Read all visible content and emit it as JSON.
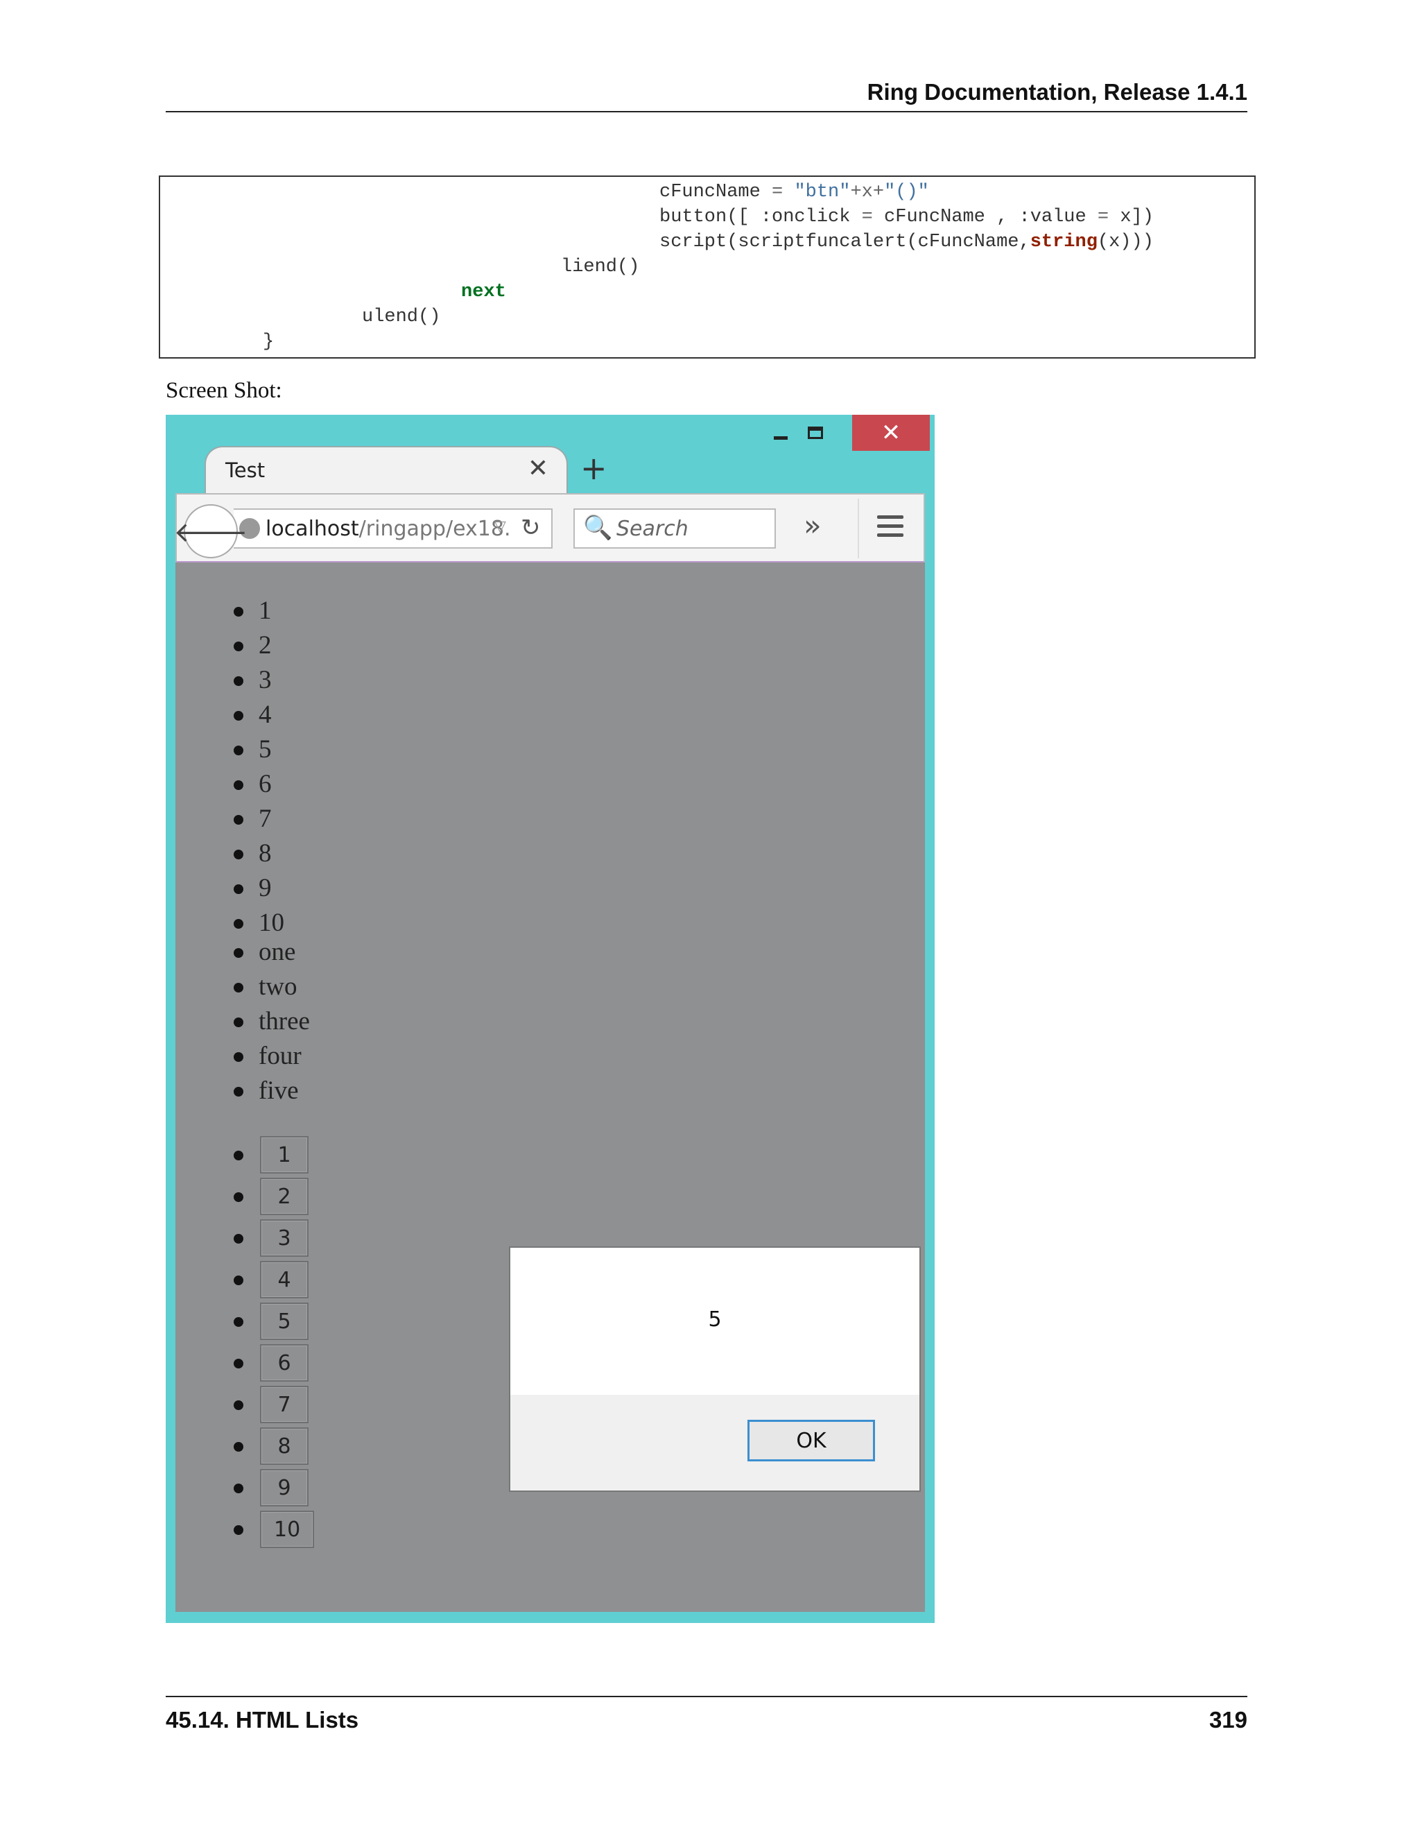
{
  "header": {
    "title": "Ring Documentation, Release 1.4.1"
  },
  "code": {
    "line1": {
      "a": "cFuncName ",
      "op": "= ",
      "str": "\"btn\"",
      "b": "+x+",
      "str2": "\"()\""
    },
    "line2": {
      "a": "button([ :onclick ",
      "op": "=",
      "b": " cFuncName , :value ",
      "op2": "=",
      "c": " x])"
    },
    "line3": {
      "a": "script(scriptfuncalert(cFuncName,",
      "fn": "string",
      "b": "(x)))"
    },
    "line4": "liend()",
    "line5": "next",
    "line6": "ulend()",
    "line7": "}"
  },
  "caption": "Screen Shot:",
  "browser": {
    "tab_title": "Test",
    "new_tab": "+",
    "url_host": "localhost",
    "url_path": "/ringapp/ex18.",
    "search_placeholder": "Search",
    "overflow": "»",
    "close": "✕",
    "tab_close": "✕",
    "back": "🡐",
    "reload": "↻",
    "dropdown": "▽",
    "search_glyph": "🔍"
  },
  "lists": {
    "numbers": [
      "1",
      "2",
      "3",
      "4",
      "5",
      "6",
      "7",
      "8",
      "9",
      "10"
    ],
    "words": [
      "one",
      "two",
      "three",
      "four",
      "five"
    ],
    "buttons": [
      "1",
      "2",
      "3",
      "4",
      "5",
      "6",
      "7",
      "8",
      "9",
      "10"
    ]
  },
  "dialog": {
    "message": "5",
    "ok_label": "OK"
  },
  "footer": {
    "section": "45.14.  HTML Lists",
    "page": "319"
  },
  "colors": {
    "accent": "#5fcfd2",
    "close": "#c9474f",
    "content_bg": "#8f9092"
  }
}
